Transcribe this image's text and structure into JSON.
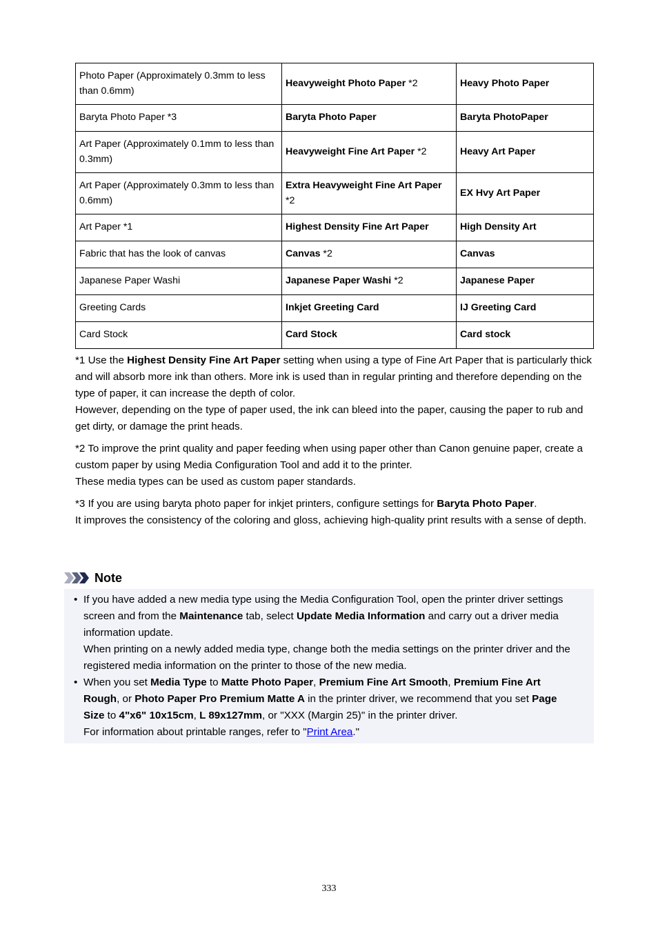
{
  "table": {
    "rows": [
      {
        "col1": "Photo Paper (Approximately 0.3mm to less than 0.6mm)",
        "col2": "Heavyweight Photo Paper",
        "col2_suffix": " *2",
        "col3": "Heavy Photo Paper"
      },
      {
        "col1": "Baryta Photo Paper *3",
        "col2": "Baryta Photo Paper",
        "col2_suffix": "",
        "col3": "Baryta PhotoPaper"
      },
      {
        "col1": "Art Paper (Approximately 0.1mm to less than 0.3mm)",
        "col2": "Heavyweight Fine Art Paper",
        "col2_suffix": " *2",
        "col3": "Heavy Art Paper"
      },
      {
        "col1": "Art Paper (Approximately 0.3mm to less than 0.6mm)",
        "col2": "Extra Heavyweight Fine Art Paper",
        "col2_suffix": " *2",
        "col3": "EX Hvy Art Paper"
      },
      {
        "col1": "Art Paper *1",
        "col2": "Highest Density Fine Art Paper",
        "col2_suffix": "",
        "col3": "High Density Art"
      },
      {
        "col1": "Fabric that has the look of canvas",
        "col2": "Canvas",
        "col2_suffix": " *2",
        "col3": "Canvas"
      },
      {
        "col1": "Japanese Paper Washi",
        "col2": "Japanese Paper Washi",
        "col2_suffix": " *2",
        "col3": "Japanese Paper"
      },
      {
        "col1": "Greeting Cards",
        "col2": "Inkjet Greeting Card",
        "col2_suffix": "",
        "col3": "IJ Greeting Card"
      },
      {
        "col1": "Card Stock",
        "col2": "Card Stock",
        "col2_suffix": "",
        "col3": "Card stock"
      }
    ]
  },
  "footnotes": {
    "fn1": {
      "prefix": "*1 Use the ",
      "bold": "Highest Density Fine Art Paper",
      "rest": " setting when using a type of Fine Art Paper that is particularly thick and will absorb more ink than others. More ink is used than in regular printing and therefore depending on the type of paper, it can increase the depth of color.",
      "line2": "However, depending on the type of paper used, the ink can bleed into the paper, causing the paper to rub and get dirty, or damage the print heads."
    },
    "fn2": {
      "line1": "*2 To improve the print quality and paper feeding when using paper other than Canon genuine paper, create a custom paper by using Media Configuration Tool and add it to the printer.",
      "line2": "These media types can be used as custom paper standards."
    },
    "fn3": {
      "prefix": "*3 If you are using baryta photo paper for inkjet printers, configure settings for ",
      "bold": "Baryta Photo Paper",
      "suffix": ".",
      "line2": "It improves the consistency of the coloring and gloss, achieving high-quality print results with a sense of depth."
    }
  },
  "note": {
    "title": "Note",
    "icon": "triple-chevron-icon",
    "bullet": "•",
    "item1": {
      "t1": "If you have added a new media type using the Media Configuration Tool, open the printer driver settings screen and from the ",
      "b1": "Maintenance",
      "t2": " tab, select ",
      "b2": "Update Media Information",
      "t3": " and carry out a driver media information update.",
      "line2": "When printing on a newly added media type, change both the media settings on the printer driver and the registered media information on the printer to those of the new media."
    },
    "item2": {
      "t1": "When you set ",
      "b1": "Media Type",
      "t2": " to ",
      "b2": "Matte Photo Paper",
      "t3": ", ",
      "b3": "Premium Fine Art Smooth",
      "t4": ", ",
      "b4": "Premium Fine Art Rough",
      "t5": ", or ",
      "b5": "Photo Paper Pro Premium Matte A",
      "t6": " in the printer driver, we recommend that you set ",
      "b6": "Page Size",
      "t7": " to ",
      "b7": "4\"x6\" 10x15cm",
      "t8": ", ",
      "b8": "L 89x127mm",
      "t9": ", or \"XXX (Margin 25)\" in the printer driver.",
      "line2_prefix": "For information about printable ranges, refer to \"",
      "link": "Print Area",
      "line2_suffix": ".\""
    }
  },
  "page_number": "333",
  "colors": {
    "note_bg": "#f2f3f9",
    "link": "#0000ee",
    "chevron_light": "#a9adbd",
    "chevron_mid": "#5a6380",
    "chevron_dark": "#1f2a4d"
  }
}
